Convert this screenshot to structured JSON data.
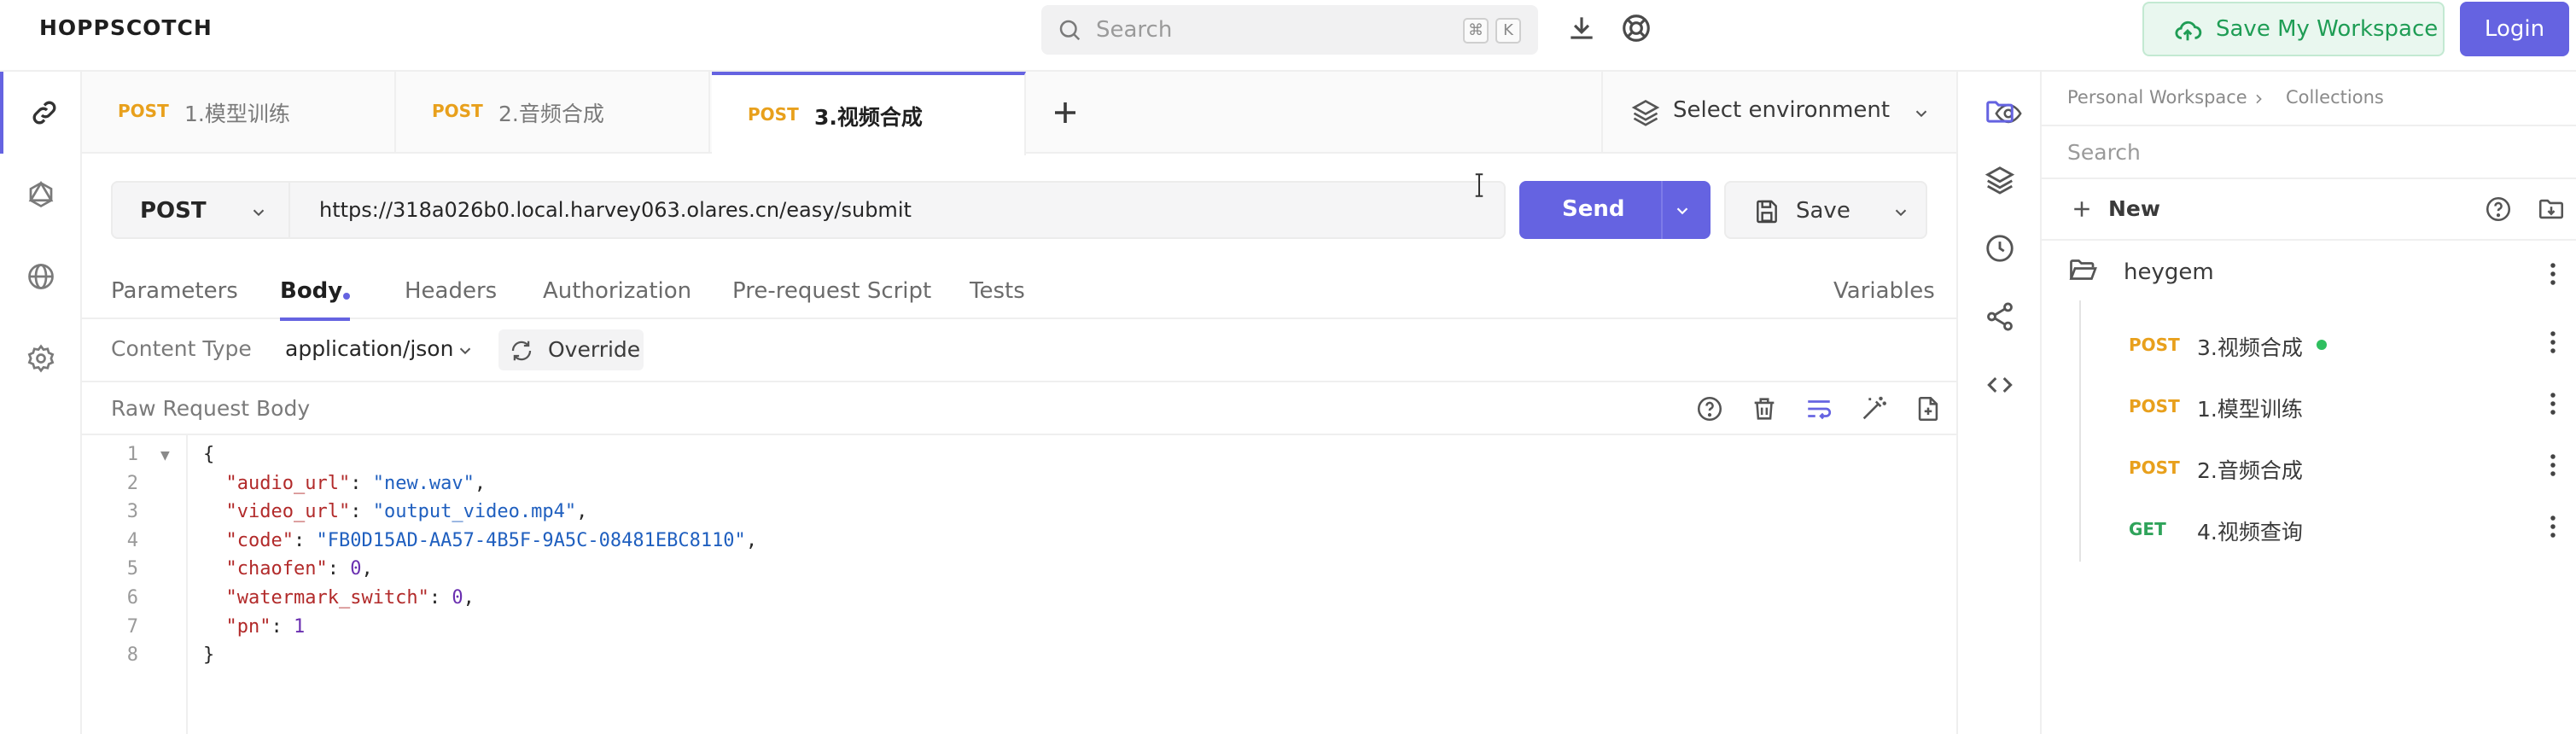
{
  "app": {
    "brand": "HOPPSCOTCH"
  },
  "search": {
    "placeholder": "Search",
    "kbd1": "⌘",
    "kbd2": "K"
  },
  "header": {
    "save_workspace": "Save My Workspace",
    "login": "Login"
  },
  "tabs": [
    {
      "method": "POST",
      "title": "1.模型训练"
    },
    {
      "method": "POST",
      "title": "2.音频合成"
    },
    {
      "method": "POST",
      "title": "3.视频合成"
    }
  ],
  "environment": {
    "label": "Select environment"
  },
  "request": {
    "method": "POST",
    "url": "https://318a026b0.local.harvey063.olares.cn/easy/submit",
    "send_label": "Send",
    "save_label": "Save"
  },
  "request_tabs": {
    "parameters": "Parameters",
    "body": "Body",
    "headers": "Headers",
    "authorization": "Authorization",
    "pre_request": "Pre-request Script",
    "tests": "Tests",
    "variables": "Variables"
  },
  "body": {
    "content_type_label": "Content Type",
    "content_type_value": "application/json",
    "override_label": "Override",
    "raw_label": "Raw Request Body",
    "line_numbers": [
      "1",
      "2",
      "3",
      "4",
      "5",
      "6",
      "7",
      "8"
    ],
    "lines": {
      "l1": "{",
      "l2_key": "\"audio_url\"",
      "l2_val": "\"new.wav\"",
      "l3_key": "\"video_url\"",
      "l3_val": "\"output_video.mp4\"",
      "l4_key": "\"code\"",
      "l4_val": "\"FB0D15AD-AA57-4B5F-9A5C-08481EBC8110\"",
      "l5_key": "\"chaofen\"",
      "l5_val": "0",
      "l6_key": "\"watermark_switch\"",
      "l6_val": "0",
      "l7_key": "\"pn\"",
      "l7_val": "1",
      "l8": "}"
    }
  },
  "collections": {
    "breadcrumb_1": "Personal Workspace",
    "breadcrumb_2": "Collections",
    "search_placeholder": "Search",
    "new_label": "New",
    "folder": "heygem",
    "requests": [
      {
        "method": "POST",
        "title": "3.视频合成"
      },
      {
        "method": "POST",
        "title": "1.模型训练"
      },
      {
        "method": "POST",
        "title": "2.音频合成"
      },
      {
        "method": "GET",
        "title": "4.视频查询"
      }
    ]
  },
  "colors": {
    "accent": "#6563e1",
    "post": "#e8a01c",
    "get": "#2fa35a",
    "json_key": "#b22a2a",
    "json_string": "#1f5fbf",
    "json_number": "#6a2fb0"
  }
}
